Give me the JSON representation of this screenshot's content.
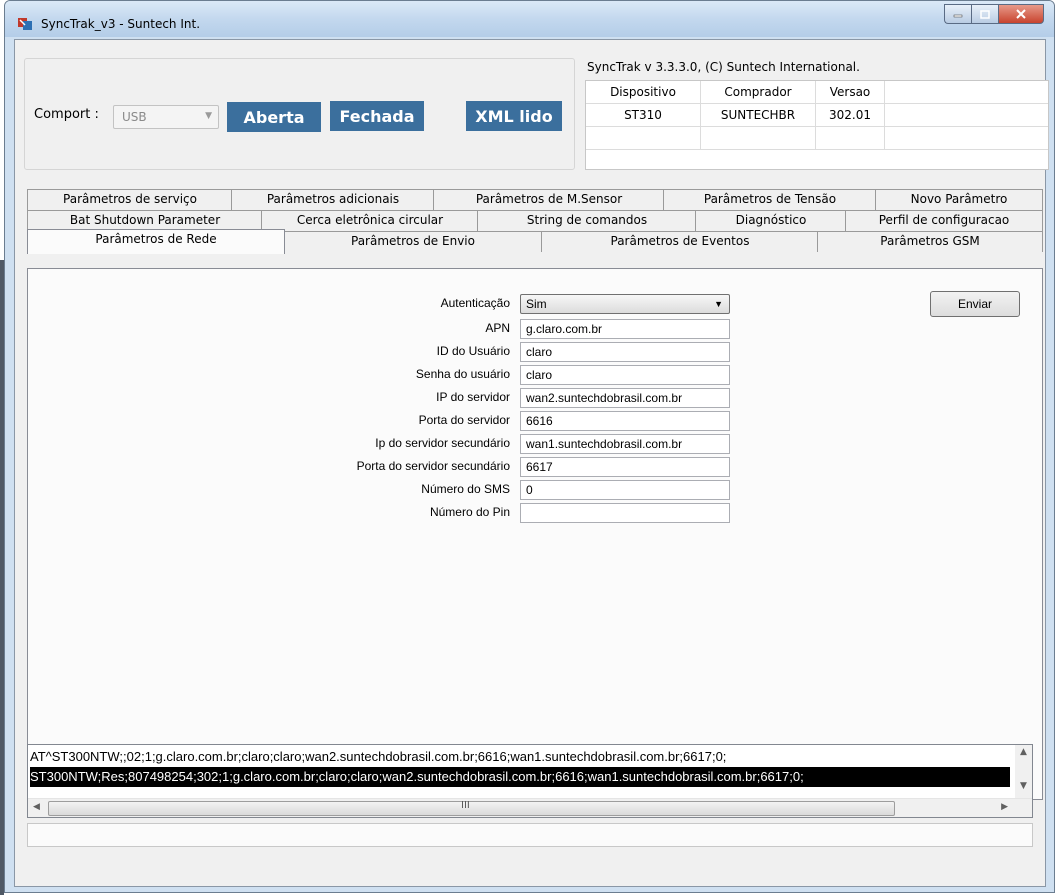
{
  "window": {
    "title": "SyncTrak_v3 - Suntech Int.",
    "caption_buttons": [
      "minimize",
      "maximize",
      "close"
    ]
  },
  "connection": {
    "comport_label": "Comport :",
    "comport_value": "USB",
    "open_button": "Aberta",
    "close_button": "Fechada",
    "xml_button": "XML lido",
    "button_color": "#3b6f9d"
  },
  "version_info": "SyncTrak v 3.3.3.0, (C) Suntech International.",
  "device_table": {
    "headers": [
      "Dispositivo",
      "Comprador",
      "Versao"
    ],
    "rows": [
      [
        "ST310",
        "SUNTECHBR",
        "302.01"
      ]
    ]
  },
  "tabs": {
    "row1": [
      "Parâmetros de serviço",
      "Parâmetros adicionais",
      "Parâmetros  de M.Sensor",
      "Parâmetros de Tensão",
      "Novo Parâmetro"
    ],
    "row2": [
      "Bat Shutdown Parameter",
      "Cerca eletrônica circular",
      "String de comandos",
      "Diagnóstico",
      "Perfil de configuracao"
    ],
    "row3": [
      "Parâmetros de Rede",
      "Parâmetros de Envio",
      "Parâmetros de Eventos",
      "Parâmetros GSM"
    ],
    "active": "Parâmetros de Rede"
  },
  "form": {
    "fields": [
      {
        "label": "Autenticação",
        "value": "Sim",
        "type": "select"
      },
      {
        "label": "APN",
        "value": "g.claro.com.br"
      },
      {
        "label": "ID do Usuário",
        "value": "claro"
      },
      {
        "label": "Senha do usuário",
        "value": "claro"
      },
      {
        "label": "IP do servidor",
        "value": "wan2.suntechdobrasil.com.br"
      },
      {
        "label": "Porta do servidor",
        "value": "6616"
      },
      {
        "label": "Ip do servidor secundário",
        "value": "wan1.suntechdobrasil.com.br"
      },
      {
        "label": "Porta do servidor secundário",
        "value": "6617"
      },
      {
        "label": "Número do SMS",
        "value": "0"
      },
      {
        "label": "Número do Pin",
        "value": ""
      }
    ],
    "send_button": "Enviar"
  },
  "log": {
    "lines": [
      "AT^ST300NTW;;02;1;g.claro.com.br;claro;claro;wan2.suntechdobrasil.com.br;6616;wan1.suntechdobrasil.com.br;6617;0;",
      "ST300NTW;Res;807498254;302;1;g.claro.com.br;claro;claro;wan2.suntechdobrasil.com.br;6616;wan1.suntechdobrasil.com.br;6617;0;"
    ],
    "selected_line": 1,
    "scroll_grip": "III"
  },
  "status_text": ""
}
